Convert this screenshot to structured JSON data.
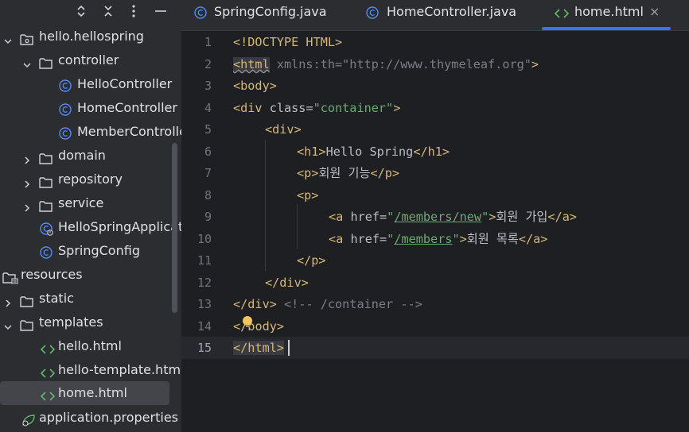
{
  "toolbar": {
    "icons": [
      "expand-icon",
      "collapse-icon",
      "more-icon",
      "minimize-icon"
    ]
  },
  "tree": {
    "items": [
      {
        "label": "hello.hellospring",
        "icon": "package"
      },
      {
        "label": "controller",
        "icon": "folder"
      },
      {
        "label": "HelloController",
        "icon": "class"
      },
      {
        "label": "HomeController",
        "icon": "class"
      },
      {
        "label": "MemberController",
        "icon": "class"
      },
      {
        "label": "domain",
        "icon": "folder"
      },
      {
        "label": "repository",
        "icon": "folder"
      },
      {
        "label": "service",
        "icon": "folder"
      },
      {
        "label": "HelloSpringApplication",
        "icon": "spring-class"
      },
      {
        "label": "SpringConfig",
        "icon": "class"
      },
      {
        "label": "resources",
        "icon": "resources-folder"
      },
      {
        "label": "static",
        "icon": "folder"
      },
      {
        "label": "templates",
        "icon": "folder"
      },
      {
        "label": "hello.html",
        "icon": "html"
      },
      {
        "label": "hello-template.html",
        "icon": "html"
      },
      {
        "label": "home.html",
        "icon": "html"
      },
      {
        "label": "application.properties",
        "icon": "spring-properties"
      }
    ]
  },
  "tabs": [
    {
      "label": "SpringConfig.java",
      "icon": "class"
    },
    {
      "label": "HomeController.java",
      "icon": "class"
    },
    {
      "label": "home.html",
      "icon": "html",
      "active": true,
      "close": "×"
    }
  ],
  "editor": {
    "line_numbers": [
      "1",
      "2",
      "3",
      "4",
      "5",
      "6",
      "7",
      "8",
      "9",
      "10",
      "11",
      "12",
      "13",
      "14",
      "15"
    ],
    "current_line": "15",
    "code": {
      "l1": {
        "a": "<!DOCTYPE HTML>"
      },
      "l2": {
        "a": "<html",
        "b": " xmlns:th=",
        "c": "\"http://www.thymeleaf.org\"",
        "d": ">"
      },
      "l3": {
        "a": "<body>"
      },
      "l4": {
        "a": "<div",
        "b": " class=",
        "c": "\"container\"",
        "d": ">"
      },
      "l5": {
        "a": "<div>"
      },
      "l6": {
        "a": "<h1>",
        "b": "Hello Spring",
        "c": "</h1>"
      },
      "l7": {
        "a": "<p>",
        "b": "회원 기능",
        "c": "</p>"
      },
      "l8": {
        "a": "<p>"
      },
      "l9": {
        "a": "<a",
        "b": " href=",
        "c": "\"",
        "d": "/members/new",
        "e": "\"",
        "f": ">",
        "g": "회원 가입",
        "h": "</a>"
      },
      "l10": {
        "a": "<a",
        "b": " href=",
        "c": "\"",
        "d": "/members",
        "e": "\"",
        "f": ">",
        "g": "회원 목록",
        "h": "</a>"
      },
      "l11": {
        "a": "</p>"
      },
      "l12": {
        "a": "</div>"
      },
      "l13": {
        "a": "</div>",
        "b": " <!-- /container -->"
      },
      "l14": {
        "a": "</",
        "b": "body>"
      },
      "l15": {
        "a": "</html>"
      }
    }
  },
  "colors": {
    "accent": "#3574f0",
    "tag": "#d5b778",
    "string": "#6aab73",
    "comment": "#7a7e85",
    "background": "#1e1f22",
    "panel": "#2b2d30"
  }
}
